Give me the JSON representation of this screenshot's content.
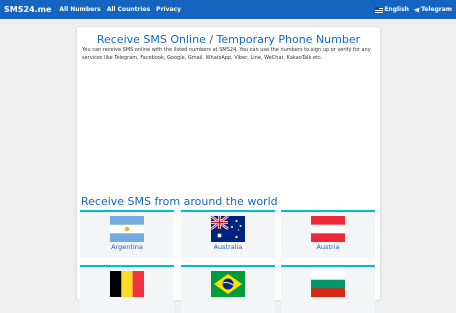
{
  "nav": {
    "brand": "SMS24.me",
    "links": [
      "All Numbers",
      "All Countries",
      "Privacy"
    ],
    "language": "English",
    "telegram": "Telegram"
  },
  "main": {
    "title": "Receive SMS Online / Temporary Phone Number",
    "description": "You can receive SMS online with the listed numbers at SMS24. You can use the numbers to sign up or verify for any services like Telegram, Facebook, Google, Gmail, WhatsApp, Viber, Line, WeChat, KakaoTalk etc.",
    "section_title": "Receive SMS from around the world"
  },
  "countries": [
    {
      "name": "Argentina"
    },
    {
      "name": "Australia"
    },
    {
      "name": "Austria"
    },
    {
      "name": ""
    },
    {
      "name": ""
    },
    {
      "name": ""
    }
  ]
}
